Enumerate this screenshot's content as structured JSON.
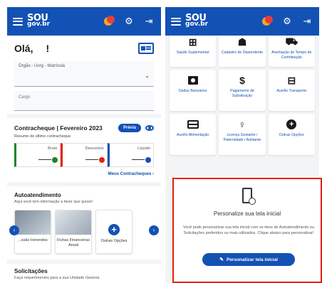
{
  "header": {
    "logo_line1": "SOU",
    "logo_line2": "gov.br",
    "gear_glyph": "⚙",
    "exit_glyph": "⇥"
  },
  "left": {
    "greeting": "Olá,",
    "greeting_name": "!",
    "orgao_label": "Órgão - Uorg - Matrícula",
    "cargo_label": "Cargo",
    "contracheque": {
      "title": "Contracheque | Fevereiro 2023",
      "prev_button": "Prévia",
      "subtitle": "Resumo do último contracheque",
      "values": [
        {
          "label": "Bruto"
        },
        {
          "label": "Descontos"
        },
        {
          "label": "Líquido"
        }
      ],
      "link": "Meus Contracheques ›"
    },
    "autoatendimento": {
      "title": "Autoatendimento",
      "subtitle": "Aqui você tem informação a favor que quiser!",
      "tiles": [
        {
          "label": "...ssão Herendos"
        },
        {
          "label": "Fichas Financeiras Anual"
        },
        {
          "label": "Outras Opções"
        }
      ]
    },
    "solicitacoes": {
      "title": "Solicitações",
      "subtitle": "Faça requerimentos para a sua Unidade Gestora"
    }
  },
  "right": {
    "tiles": [
      {
        "label": "Saúde Suplementar"
      },
      {
        "label": "Cadastro de Dependente"
      },
      {
        "label": "Averbação de Tempo de Contribuição"
      },
      {
        "label": "Dados Bancários"
      },
      {
        "label": "Pagamento de Substituição"
      },
      {
        "label": "Auxílio Transporte"
      },
      {
        "label": "Auxílio Alimentação"
      },
      {
        "label": "Licença Gestante / Paternidade / Adotante"
      },
      {
        "label": "Outras Opções"
      }
    ],
    "personalize": {
      "title": "Personalize sua tela inicial",
      "text": "Você pode personalizar sua tela inicial com os itens de Autoatendimento ou Solicitações preferidos ou mais utilizados. Clique abaixo para personalizar!",
      "button": "Personalizar tela inicial"
    }
  },
  "colors": {
    "primary": "#1351b4",
    "highlight": "#e52207",
    "success": "#168821"
  }
}
